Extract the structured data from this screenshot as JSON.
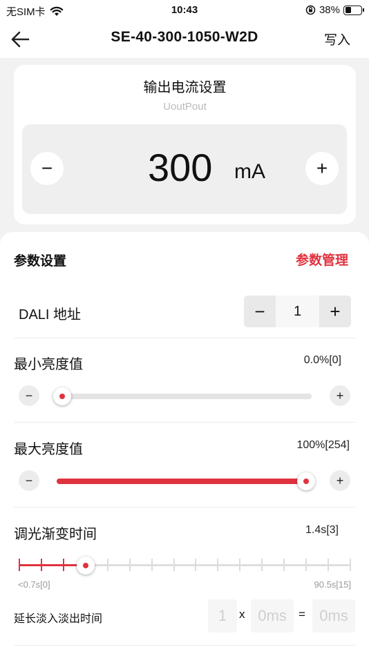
{
  "status_bar": {
    "carrier": "无SIM卡",
    "time": "10:43",
    "battery_text": "38%",
    "battery_level": 0.38
  },
  "nav": {
    "title": "SE-40-300-1050-W2D",
    "write_label": "写入"
  },
  "output_current": {
    "title": "输出电流设置",
    "subtitle": "UoutPout",
    "value": "300",
    "unit": "mA",
    "minus": "−",
    "plus": "+"
  },
  "params": {
    "header": "参数设置",
    "manage_label": "参数管理",
    "dali": {
      "label": "DALI 地址",
      "value": "1",
      "minus": "−",
      "plus": "+"
    },
    "min_brightness": {
      "label": "最小亮度值",
      "value_text": "0.0%[0]",
      "level": 0.0,
      "minus": "−",
      "plus": "+"
    },
    "max_brightness": {
      "label": "最大亮度值",
      "value_text": "100%[254]",
      "level": 1.0,
      "minus": "−",
      "plus": "+"
    },
    "dim_fade": {
      "label": "调光渐变时间",
      "value_text": "1.4s[3]",
      "step_index": 3,
      "step_count": 15,
      "min_label": "<0.7s[0]",
      "max_label": "90.5s[15]"
    },
    "extended_fade": {
      "label": "延长淡入淡出时间",
      "multiplier": "1",
      "times": "x",
      "base": "0ms",
      "equals": "=",
      "result": "0ms"
    }
  },
  "colors": {
    "accent": "#e0323f",
    "background": "#f2f2f2"
  },
  "icons": {
    "back": "arrow-left-icon",
    "wifi": "wifi-icon",
    "lock": "rotation-lock-icon",
    "battery": "battery-icon"
  }
}
